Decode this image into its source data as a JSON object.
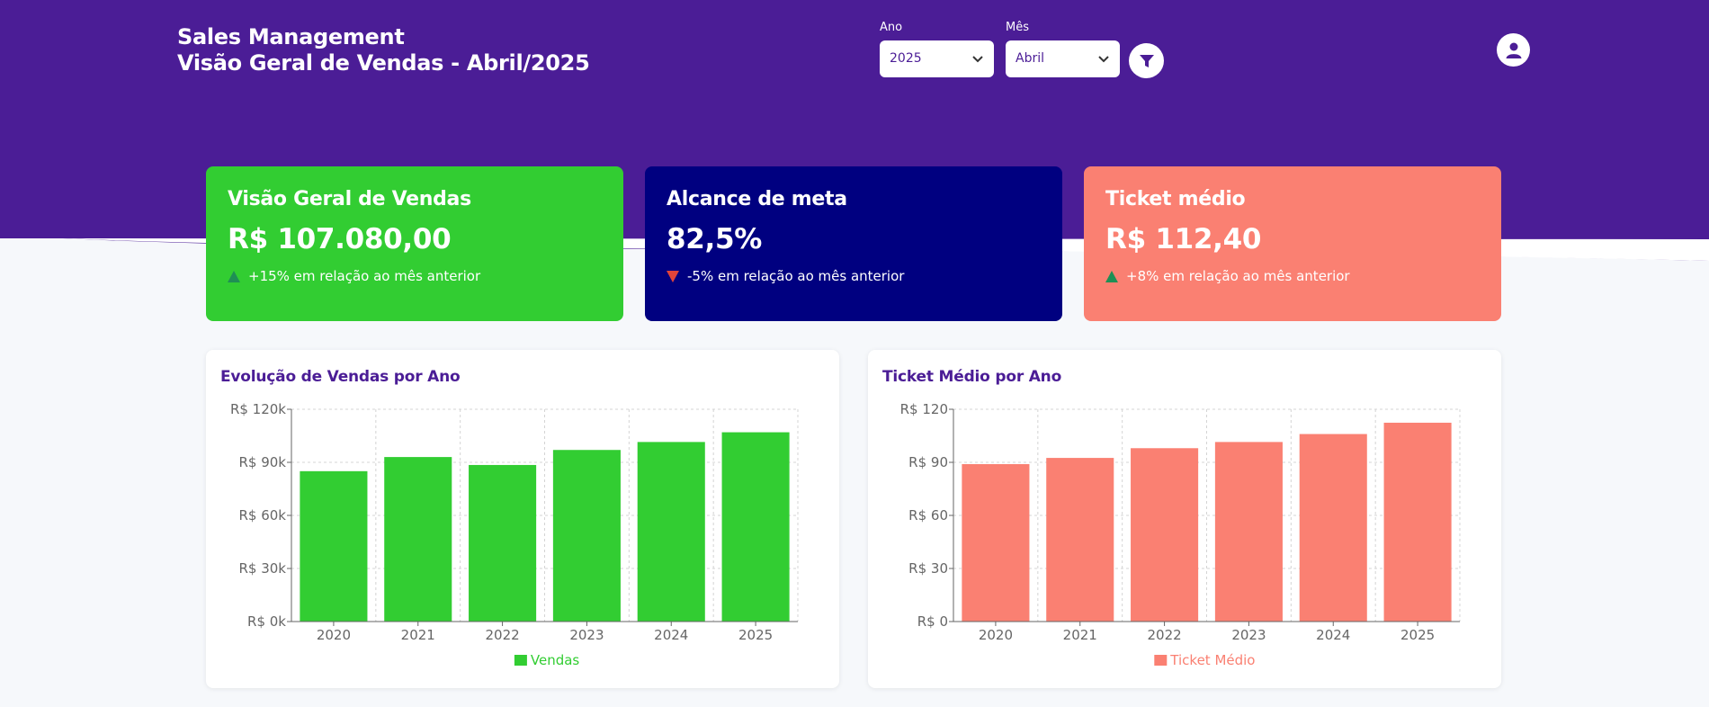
{
  "header": {
    "title": "Sales Management",
    "subtitle": "Visão Geral de Vendas - Abril/2025",
    "year_label": "Ano",
    "year_value": "2025",
    "month_label": "Mês",
    "month_value": "Abril",
    "filter_icon": "filter-icon",
    "user_icon": "user-icon"
  },
  "colors": {
    "primary": "#4b1d96",
    "green": "#32cd32",
    "navy": "#000080",
    "salmon": "#fa8072"
  },
  "kpis": [
    {
      "title": "Visão Geral de Vendas",
      "value": "R$ 107.080,00",
      "change": "+15% em relação ao mês anterior",
      "trend": "up"
    },
    {
      "title": "Alcance de meta",
      "value": "82,5%",
      "change": "-5% em relação ao mês anterior",
      "trend": "down"
    },
    {
      "title": "Ticket médio",
      "value": "R$ 112,40",
      "change": "+8% em relação ao mês anterior",
      "trend": "up"
    }
  ],
  "chart_data": [
    {
      "type": "bar",
      "title": "Evolução de Vendas por Ano",
      "categories": [
        "2020",
        "2021",
        "2022",
        "2023",
        "2024",
        "2025"
      ],
      "series": [
        {
          "name": "Vendas",
          "values": [
            85000,
            93000,
            88500,
            97000,
            101500,
            107000
          ]
        }
      ],
      "ylim": [
        0,
        120000
      ],
      "yticks": [
        "R$ 0k",
        "R$ 30k",
        "R$ 60k",
        "R$ 90k",
        "R$ 120k"
      ],
      "grid": true,
      "legend": "bottom",
      "color": "#32cd32"
    },
    {
      "type": "bar",
      "title": "Ticket Médio por Ano",
      "categories": [
        "2020",
        "2021",
        "2022",
        "2023",
        "2024",
        "2025"
      ],
      "series": [
        {
          "name": "Ticket Médio",
          "values": [
            89,
            92.5,
            98,
            101.5,
            106,
            112.4
          ]
        }
      ],
      "ylim": [
        0,
        120
      ],
      "yticks": [
        "R$ 0",
        "R$ 30",
        "R$ 60",
        "R$ 90",
        "R$ 120"
      ],
      "grid": true,
      "legend": "bottom",
      "color": "#fa8072"
    }
  ]
}
